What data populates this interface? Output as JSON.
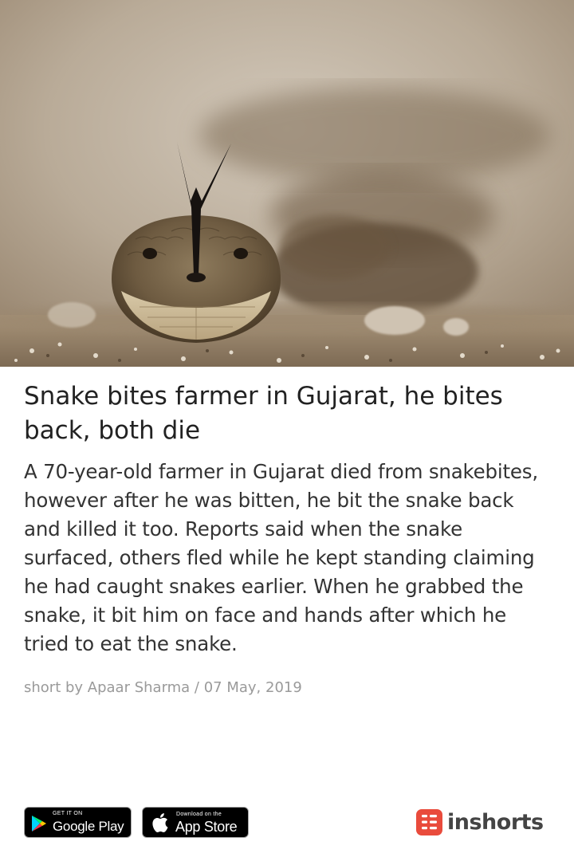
{
  "article": {
    "image_subject": "Snake close-up with forked tongue",
    "headline": "Snake bites farmer in Gujarat, he bites back, both die",
    "body": "A 70-year-old farmer in Gujarat died from snakebites, however after he was bitten, he bit the snake back and killed it too. Reports said when the snake surfaced, others fled while he kept standing claiming he had caught snakes earlier. When he grabbed the snake, it bit him on face and hands after which he tried to eat the snake.",
    "byline": "short by Apaar Sharma / 07 May, 2019"
  },
  "footer": {
    "google_play": {
      "small": "GET IT ON",
      "big": "Google Play"
    },
    "app_store": {
      "small": "Download on the",
      "big": "App Store"
    },
    "brand": {
      "name": "inshorts",
      "color": "#e94b3c"
    }
  },
  "colors": {
    "headline": "#222222",
    "body": "#333333",
    "byline": "#9a9a9a",
    "badge_bg": "#000000"
  }
}
